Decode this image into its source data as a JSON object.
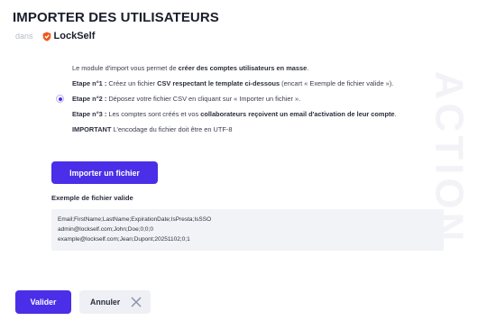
{
  "header": {
    "title": "IMPORTER DES UTILISATEURS",
    "context_prefix": "dans",
    "brand_name": "LockSelf",
    "watermark": "ACTION"
  },
  "instructions": {
    "intro_plain": "Le module d'import vous permet de ",
    "intro_bold": "créer des comptes utilisateurs en masse",
    "intro_end": ".",
    "step1_label": "Etape n°1 :",
    "step1_plain": " Créez un fichier ",
    "step1_bold": "CSV respectant le template ci-dessous",
    "step1_end": " (encart « Exemple de fichier valide »).",
    "step2_label": "Etape n°2 :",
    "step2_text": " Déposez votre fichier CSV en cliquant sur « Importer un fichier ».",
    "step3_label": "Etape n°3 :",
    "step3_plain": " Les comptes sont créés et vos ",
    "step3_bold": "collaborateurs reçoivent un email d'activation de leur compte",
    "step3_end": ".",
    "important_label": "IMPORTANT",
    "important_text": " L'encodage du fichier doit être en UTF-8"
  },
  "import_button": {
    "label": "Importer un fichier"
  },
  "example": {
    "title": "Exemple de fichier valide",
    "lines": [
      "Email;FirstName;LastName;ExpirationDate;IsPresta;IsSSO",
      "admin@lockself.com;John;Doe;0;0;0",
      "example@lockself.com;Jean;Dupont;20251102;0;1"
    ]
  },
  "footer": {
    "validate_label": "Valider",
    "cancel_label": "Annuler"
  },
  "colors": {
    "accent": "#4a2ee8",
    "brand_orange": "#f0581e",
    "example_bg": "#f1f3f7"
  }
}
